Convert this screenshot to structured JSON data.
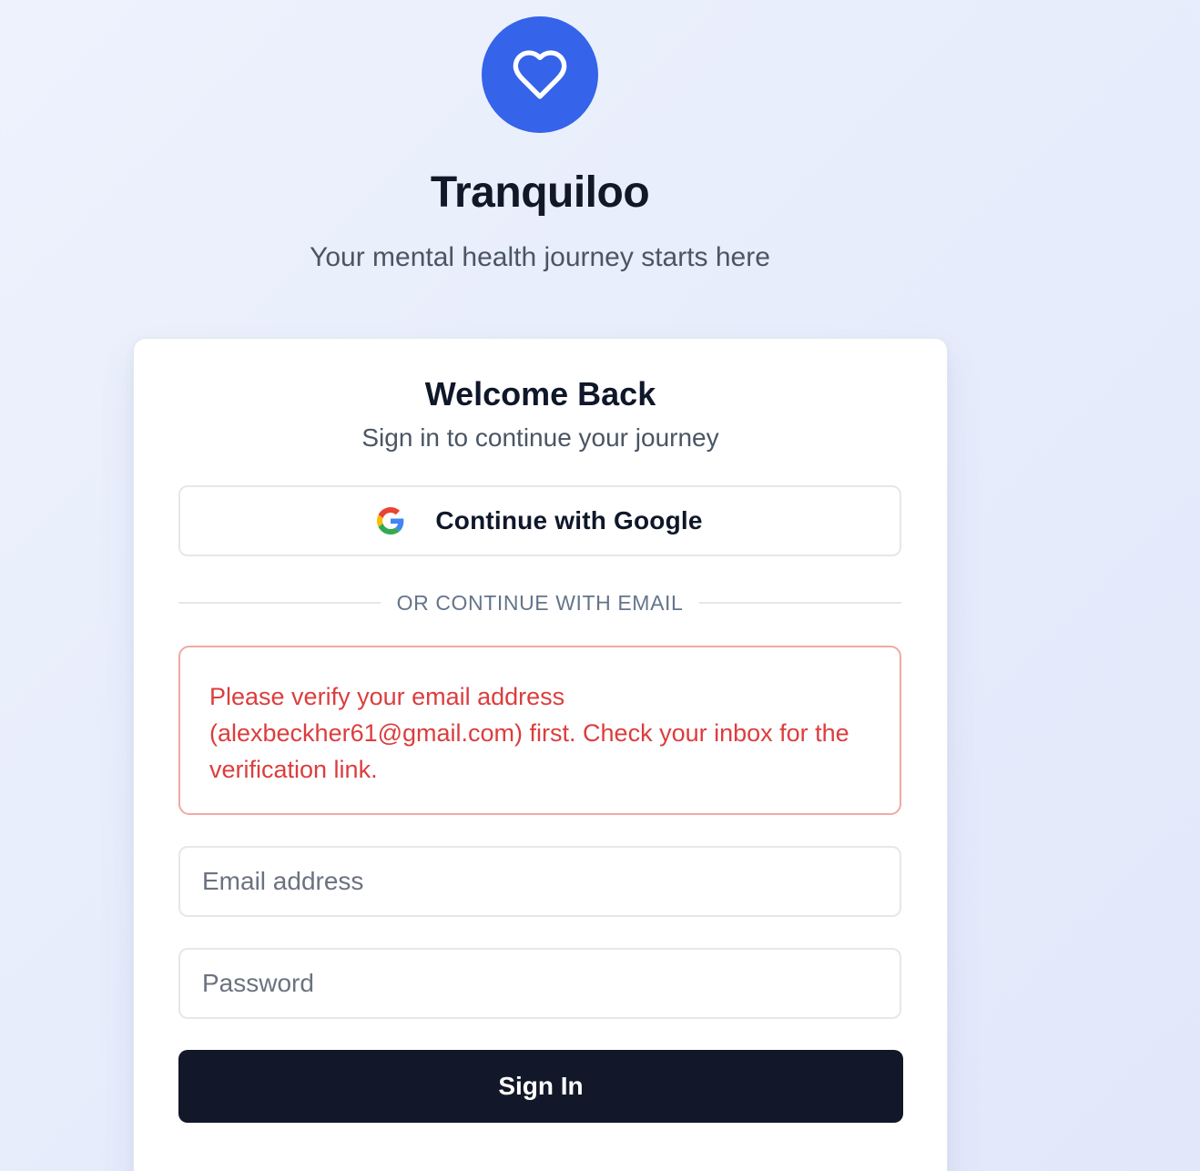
{
  "brand": {
    "name": "Tranquiloo",
    "tagline": "Your mental health journey starts here",
    "logo_icon": "heart-icon",
    "accent_color": "#3563e9"
  },
  "login_card": {
    "title": "Welcome Back",
    "subtitle": "Sign in to continue your journey",
    "google_button": {
      "label": "Continue with Google",
      "icon": "google-icon"
    },
    "divider_text": "OR CONTINUE WITH EMAIL",
    "error_message": "Please verify your email address (alexbeckher61@gmail.com) first. Check your inbox for the verification link.",
    "error_color": "#dc3d3d",
    "email_field": {
      "placeholder": "Email address",
      "value": ""
    },
    "password_field": {
      "placeholder": "Password",
      "value": ""
    },
    "submit_button": {
      "label": "Sign In",
      "color": "#121829"
    }
  }
}
